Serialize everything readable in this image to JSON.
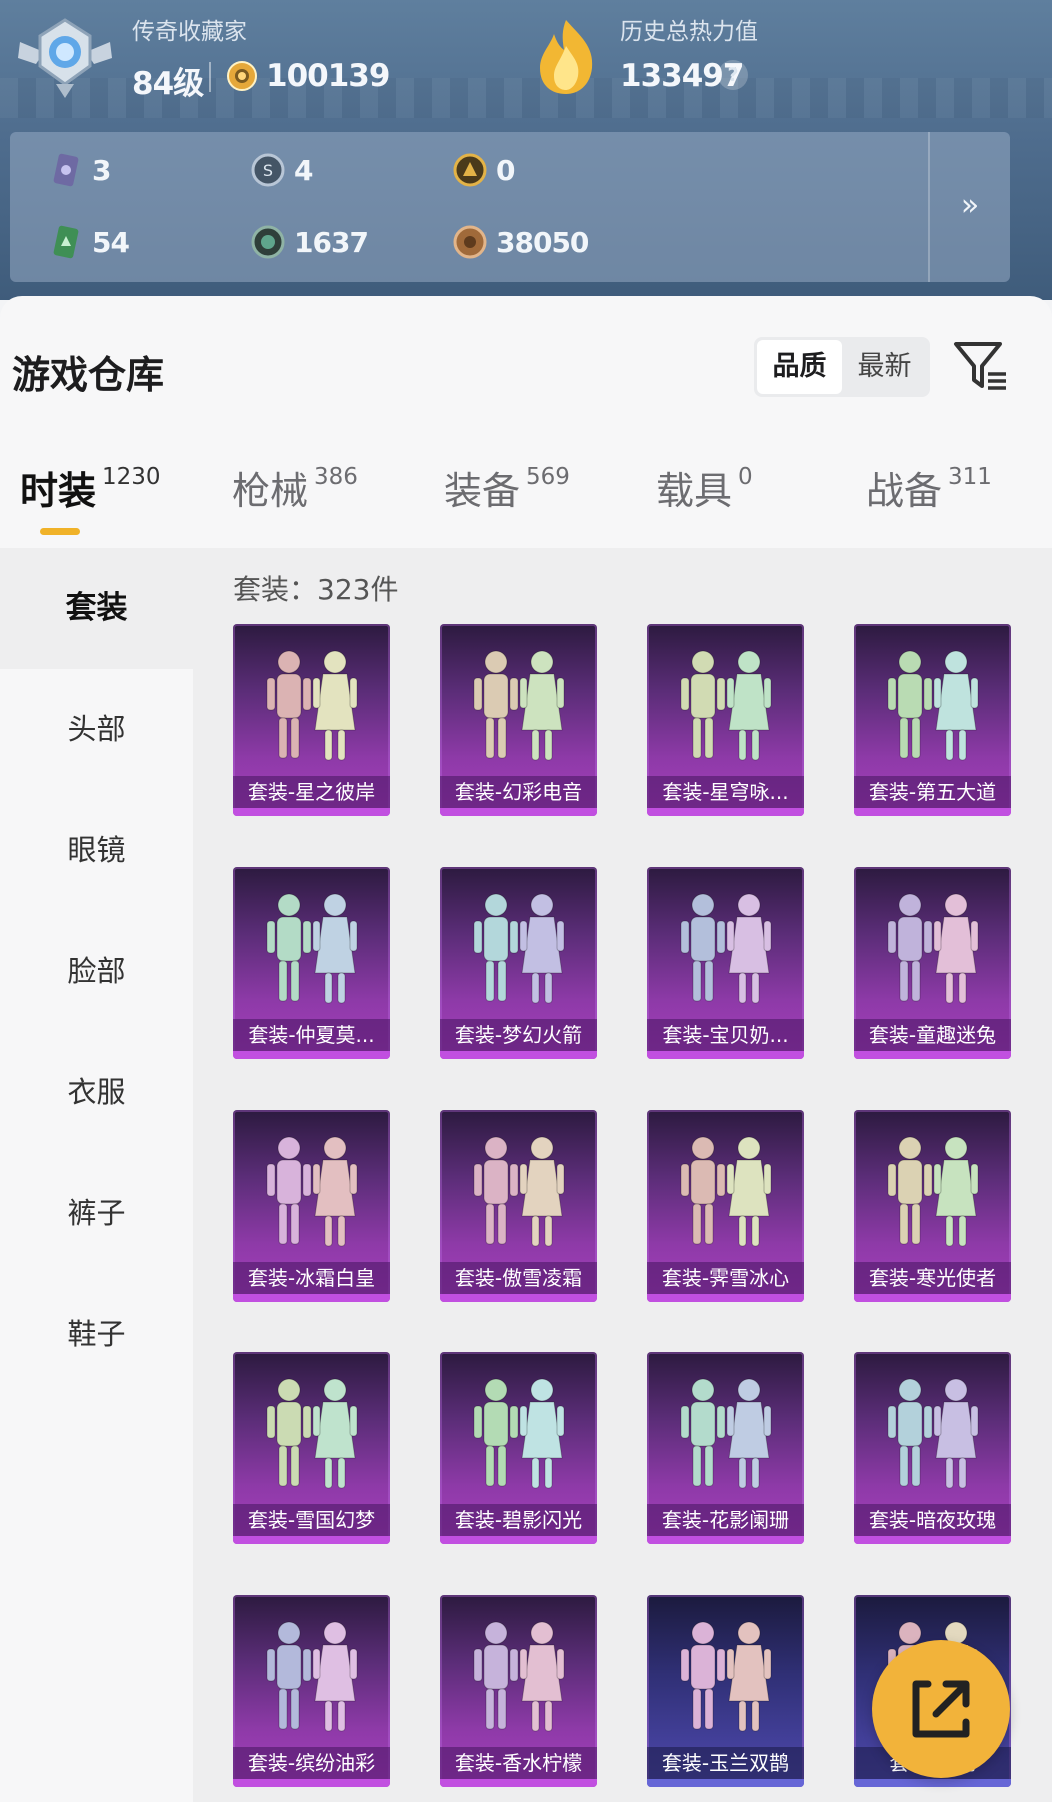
{
  "header": {
    "badge_icon": "legend-rank-emblem-icon",
    "collector_title": "传奇收藏家",
    "level": "84级",
    "coin_icon": "medal-coin-icon",
    "coins": "100139",
    "heat_icon": "flame-icon",
    "heat_title": "历史总热力值",
    "heat_value": "133497",
    "help_icon": "?"
  },
  "stats": {
    "items": [
      {
        "icon": "card-icon",
        "value": "3"
      },
      {
        "icon": "s-token-icon",
        "value": "4"
      },
      {
        "icon": "gold-token-icon",
        "value": "0"
      },
      {
        "icon": "green-card-icon",
        "value": "54"
      },
      {
        "icon": "gem-icon",
        "value": "1637"
      },
      {
        "icon": "bronze-coin-icon",
        "value": "38050"
      }
    ],
    "more": "»"
  },
  "warehouse": {
    "title": "游戏仓库",
    "sort_options": [
      "品质",
      "最新"
    ],
    "sort_selected": "品质"
  },
  "tabs": [
    {
      "label": "时装",
      "count": "1230",
      "active": true
    },
    {
      "label": "枪械",
      "count": "386"
    },
    {
      "label": "装备",
      "count": "569"
    },
    {
      "label": "载具",
      "count": "0"
    },
    {
      "label": "战备",
      "count": "311"
    }
  ],
  "sidebar": [
    "套装",
    "头部",
    "眼镜",
    "脸部",
    "衣服",
    "裤子",
    "鞋子"
  ],
  "sidebar_selected": "套装",
  "count_label": "套装：323件",
  "items": [
    "套装-星之彼岸",
    "套装-幻彩电音",
    "套装-星穹咏...",
    "套装-第五大道",
    "套装-仲夏莫...",
    "套装-梦幻火箭",
    "套装-宝贝奶...",
    "套装-童趣迷兔",
    "套装-冰霜白皇",
    "套装-傲雪凌霜",
    "套装-霁雪冰心",
    "套装-寒光使者",
    "套装-雪国幻梦",
    "套装-碧影闪光",
    "套装-花影阑珊",
    "套装-暗夜玫瑰",
    "套装-缤纷油彩",
    "套装-香水柠檬",
    "套装-玉兰双鹊",
    "套装-...礼"
  ],
  "colors": {
    "accent": "#f0b229",
    "card_purple": "#a63fbd",
    "card_blue": "#4e4aa9",
    "fab": "#f2b33a"
  },
  "fab_icon": "share-external-icon"
}
